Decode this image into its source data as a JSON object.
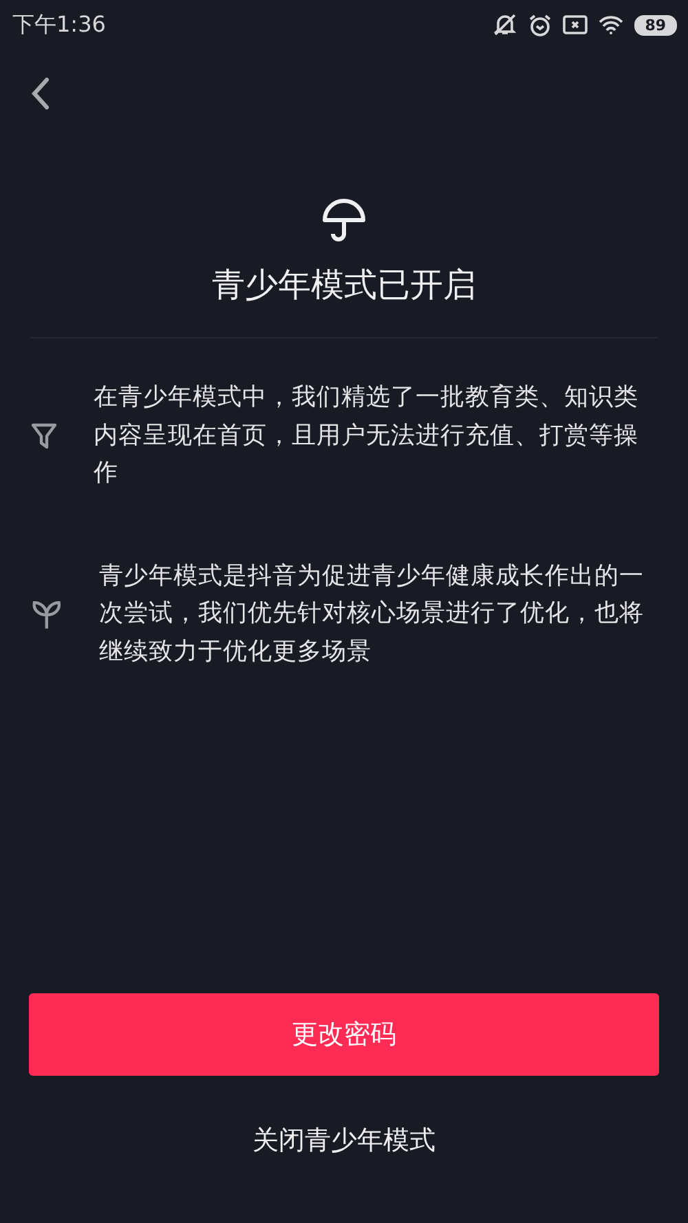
{
  "status_bar": {
    "time": "下午1:36",
    "battery": "89"
  },
  "title": "青少年模式已开启",
  "items": [
    {
      "kind": "filter",
      "text": "在青少年模式中，我们精选了一批教育类、知识类内容呈现在首页，且用户无法进行充值、打赏等操作"
    },
    {
      "kind": "sprout",
      "text": "青少年模式是抖音为促进青少年健康成长作出的一次尝试，我们优先针对核心场景进行了优化，也将继续致力于优化更多场景"
    }
  ],
  "primary_button": "更改密码",
  "secondary_link": "关闭青少年模式"
}
